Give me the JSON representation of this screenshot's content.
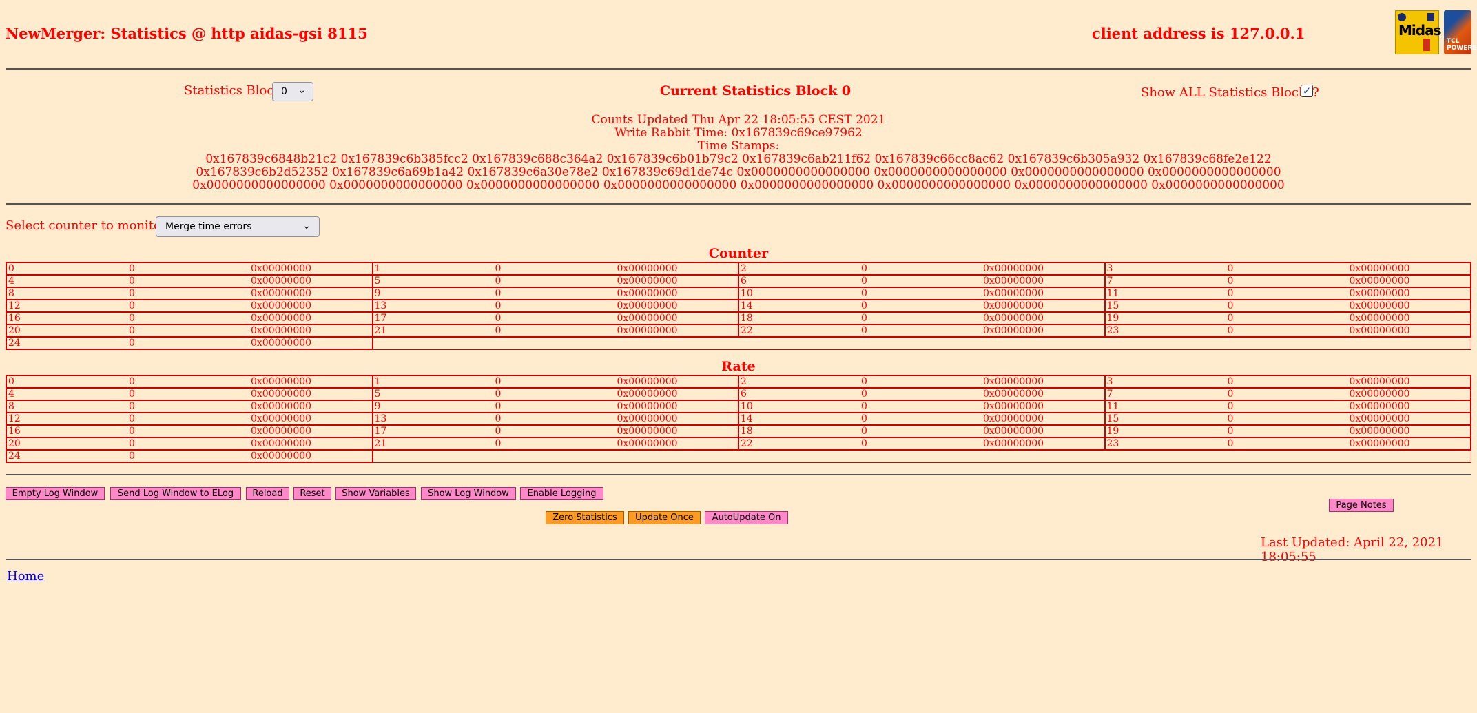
{
  "header": {
    "title": "NewMerger: Statistics @ http aidas-gsi 8115",
    "client": "client address is 127.0.0.1",
    "midas_logo_text": "Midas",
    "tcl_logo_text": "TCL POWERED"
  },
  "controls": {
    "stats_block_label": "Statistics Block",
    "stats_block_value": "0",
    "current_block": "Current Statistics Block 0",
    "show_all_label": "Show ALL Statistics Blocks?",
    "show_all_checked": true
  },
  "info": {
    "counts_updated": "Counts Updated Thu Apr 22 18:05:55 CEST 2021",
    "write_rabbit": "Write Rabbit Time: 0x167839c69ce97962",
    "timestamps_label": "Time Stamps:",
    "ts_line1": "0x167839c6848b21c2 0x167839c6b385fcc2 0x167839c688c364a2 0x167839c6b01b79c2 0x167839c6ab211f62 0x167839c66cc8ac62 0x167839c6b305a932 0x167839c68fe2e122",
    "ts_line2": "0x167839c6b2d52352 0x167839c6a69b1a42 0x167839c6a30e78e2 0x167839c69d1de74c 0x0000000000000000 0x0000000000000000 0x0000000000000000 0x0000000000000000",
    "ts_line3": "0x0000000000000000 0x0000000000000000 0x0000000000000000 0x0000000000000000 0x0000000000000000 0x0000000000000000 0x0000000000000000 0x0000000000000000"
  },
  "monitor": {
    "label": "Select counter to monitor",
    "selected": "Merge time errors"
  },
  "counter": {
    "title": "Counter",
    "rows": [
      [
        [
          "0",
          "0",
          "0x00000000"
        ],
        [
          "1",
          "0",
          "0x00000000"
        ],
        [
          "2",
          "0",
          "0x00000000"
        ],
        [
          "3",
          "0",
          "0x00000000"
        ]
      ],
      [
        [
          "4",
          "0",
          "0x00000000"
        ],
        [
          "5",
          "0",
          "0x00000000"
        ],
        [
          "6",
          "0",
          "0x00000000"
        ],
        [
          "7",
          "0",
          "0x00000000"
        ]
      ],
      [
        [
          "8",
          "0",
          "0x00000000"
        ],
        [
          "9",
          "0",
          "0x00000000"
        ],
        [
          "10",
          "0",
          "0x00000000"
        ],
        [
          "11",
          "0",
          "0x00000000"
        ]
      ],
      [
        [
          "12",
          "0",
          "0x00000000"
        ],
        [
          "13",
          "0",
          "0x00000000"
        ],
        [
          "14",
          "0",
          "0x00000000"
        ],
        [
          "15",
          "0",
          "0x00000000"
        ]
      ],
      [
        [
          "16",
          "0",
          "0x00000000"
        ],
        [
          "17",
          "0",
          "0x00000000"
        ],
        [
          "18",
          "0",
          "0x00000000"
        ],
        [
          "19",
          "0",
          "0x00000000"
        ]
      ],
      [
        [
          "20",
          "0",
          "0x00000000"
        ],
        [
          "21",
          "0",
          "0x00000000"
        ],
        [
          "22",
          "0",
          "0x00000000"
        ],
        [
          "23",
          "0",
          "0x00000000"
        ]
      ],
      [
        [
          "24",
          "0",
          "0x00000000"
        ]
      ]
    ]
  },
  "rate": {
    "title": "Rate",
    "rows": [
      [
        [
          "0",
          "0",
          "0x00000000"
        ],
        [
          "1",
          "0",
          "0x00000000"
        ],
        [
          "2",
          "0",
          "0x00000000"
        ],
        [
          "3",
          "0",
          "0x00000000"
        ]
      ],
      [
        [
          "4",
          "0",
          "0x00000000"
        ],
        [
          "5",
          "0",
          "0x00000000"
        ],
        [
          "6",
          "0",
          "0x00000000"
        ],
        [
          "7",
          "0",
          "0x00000000"
        ]
      ],
      [
        [
          "8",
          "0",
          "0x00000000"
        ],
        [
          "9",
          "0",
          "0x00000000"
        ],
        [
          "10",
          "0",
          "0x00000000"
        ],
        [
          "11",
          "0",
          "0x00000000"
        ]
      ],
      [
        [
          "12",
          "0",
          "0x00000000"
        ],
        [
          "13",
          "0",
          "0x00000000"
        ],
        [
          "14",
          "0",
          "0x00000000"
        ],
        [
          "15",
          "0",
          "0x00000000"
        ]
      ],
      [
        [
          "16",
          "0",
          "0x00000000"
        ],
        [
          "17",
          "0",
          "0x00000000"
        ],
        [
          "18",
          "0",
          "0x00000000"
        ],
        [
          "19",
          "0",
          "0x00000000"
        ]
      ],
      [
        [
          "20",
          "0",
          "0x00000000"
        ],
        [
          "21",
          "0",
          "0x00000000"
        ],
        [
          "22",
          "0",
          "0x00000000"
        ],
        [
          "23",
          "0",
          "0x00000000"
        ]
      ],
      [
        [
          "24",
          "0",
          "0x00000000"
        ]
      ]
    ]
  },
  "buttons": {
    "empty_log": "Empty Log Window",
    "send_log": "Send Log Window to ELog",
    "reload": "Reload",
    "reset": "Reset",
    "show_vars": "Show Variables",
    "show_log": "Show Log Window",
    "enable_logging": "Enable Logging",
    "page_notes": "Page Notes",
    "zero_stats": "Zero Statistics",
    "update_once": "Update Once",
    "autoupdate": "AutoUpdate On"
  },
  "footer": {
    "last_updated": "Last Updated: April 22, 2021 18:05:55",
    "home": "Home"
  },
  "colors": {
    "background": "#ffebcd",
    "text": "#ff0000",
    "button_pink": "#ff88c8",
    "button_orange": "#ff9a22"
  }
}
